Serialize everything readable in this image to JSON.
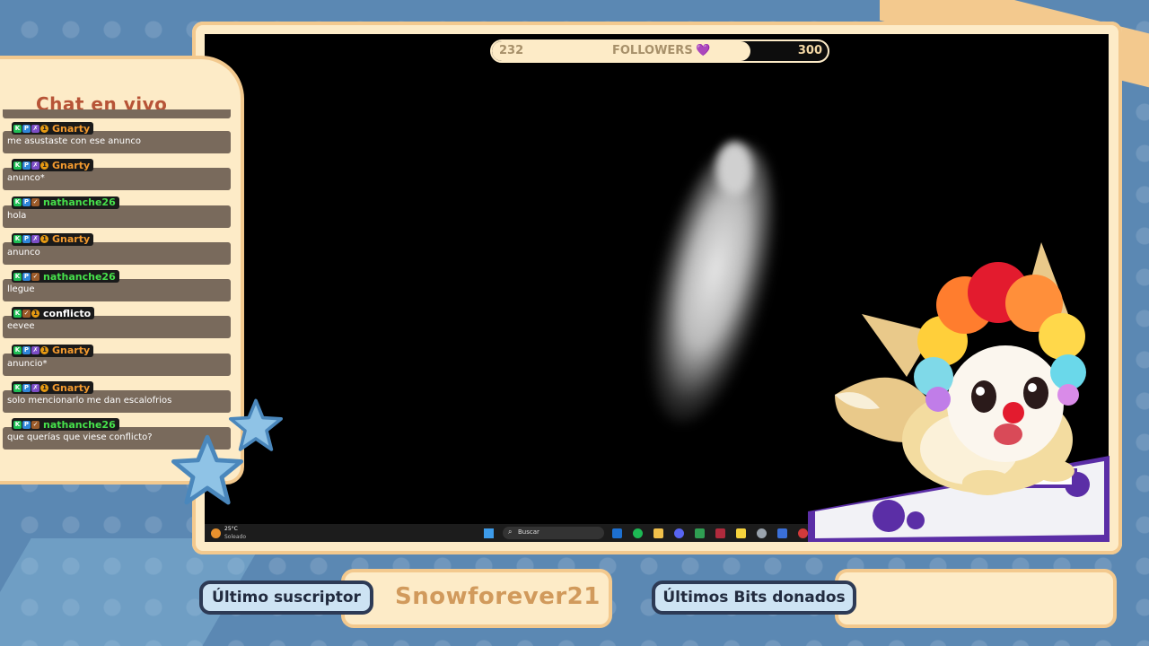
{
  "followers": {
    "current": "232",
    "label": "FOLLOWERS",
    "heart": "💜",
    "goal": "300",
    "progress": 0.77
  },
  "chat": {
    "title": "Chat en vivo",
    "messages": [
      {
        "user": "Gnarty",
        "color": "#f39a2f",
        "badges": [
          "K",
          "P",
          "✗",
          "1"
        ],
        "text": "me asustaste con ese anunco"
      },
      {
        "user": "Gnarty",
        "color": "#f39a2f",
        "badges": [
          "K",
          "P",
          "✗",
          "1"
        ],
        "text": "anunco*"
      },
      {
        "user": "nathanche26",
        "color": "#46e04b",
        "badges": [
          "K",
          "P",
          "✓"
        ],
        "text": "hola"
      },
      {
        "user": "Gnarty",
        "color": "#f39a2f",
        "badges": [
          "K",
          "P",
          "✗",
          "1"
        ],
        "text": "anunco"
      },
      {
        "user": "nathanche26",
        "color": "#46e04b",
        "badges": [
          "K",
          "P",
          "✓"
        ],
        "text": "llegue"
      },
      {
        "user": "conflicto",
        "color": "#ffffff",
        "badges": [
          "K",
          "✓",
          "1"
        ],
        "text": "eevee"
      },
      {
        "user": "Gnarty",
        "color": "#f39a2f",
        "badges": [
          "K",
          "P",
          "✗",
          "1"
        ],
        "text": "anuncio*"
      },
      {
        "user": "Gnarty",
        "color": "#f39a2f",
        "badges": [
          "K",
          "P",
          "✗",
          "1"
        ],
        "text": "solo mencionarlo me dan escalofrios"
      },
      {
        "user": "nathanche26",
        "color": "#46e04b",
        "badges": [
          "K",
          "P",
          "✓"
        ],
        "text": "que querías que viese conflicto?"
      }
    ]
  },
  "taskbar": {
    "temp": "25°C",
    "condition": "Soleado",
    "search_placeholder": "Buscar"
  },
  "bottom": {
    "last_sub_label": "Último suscriptor",
    "last_sub_value": "Snowforever21",
    "last_bits_label": "Últimos Bits donados",
    "last_bits_value": ""
  },
  "colors": {
    "cream": "#fdebc7",
    "border": "#f3c98e",
    "bg": "#5b88b3",
    "chat_body": "#796a5c",
    "title": "#b75437"
  }
}
